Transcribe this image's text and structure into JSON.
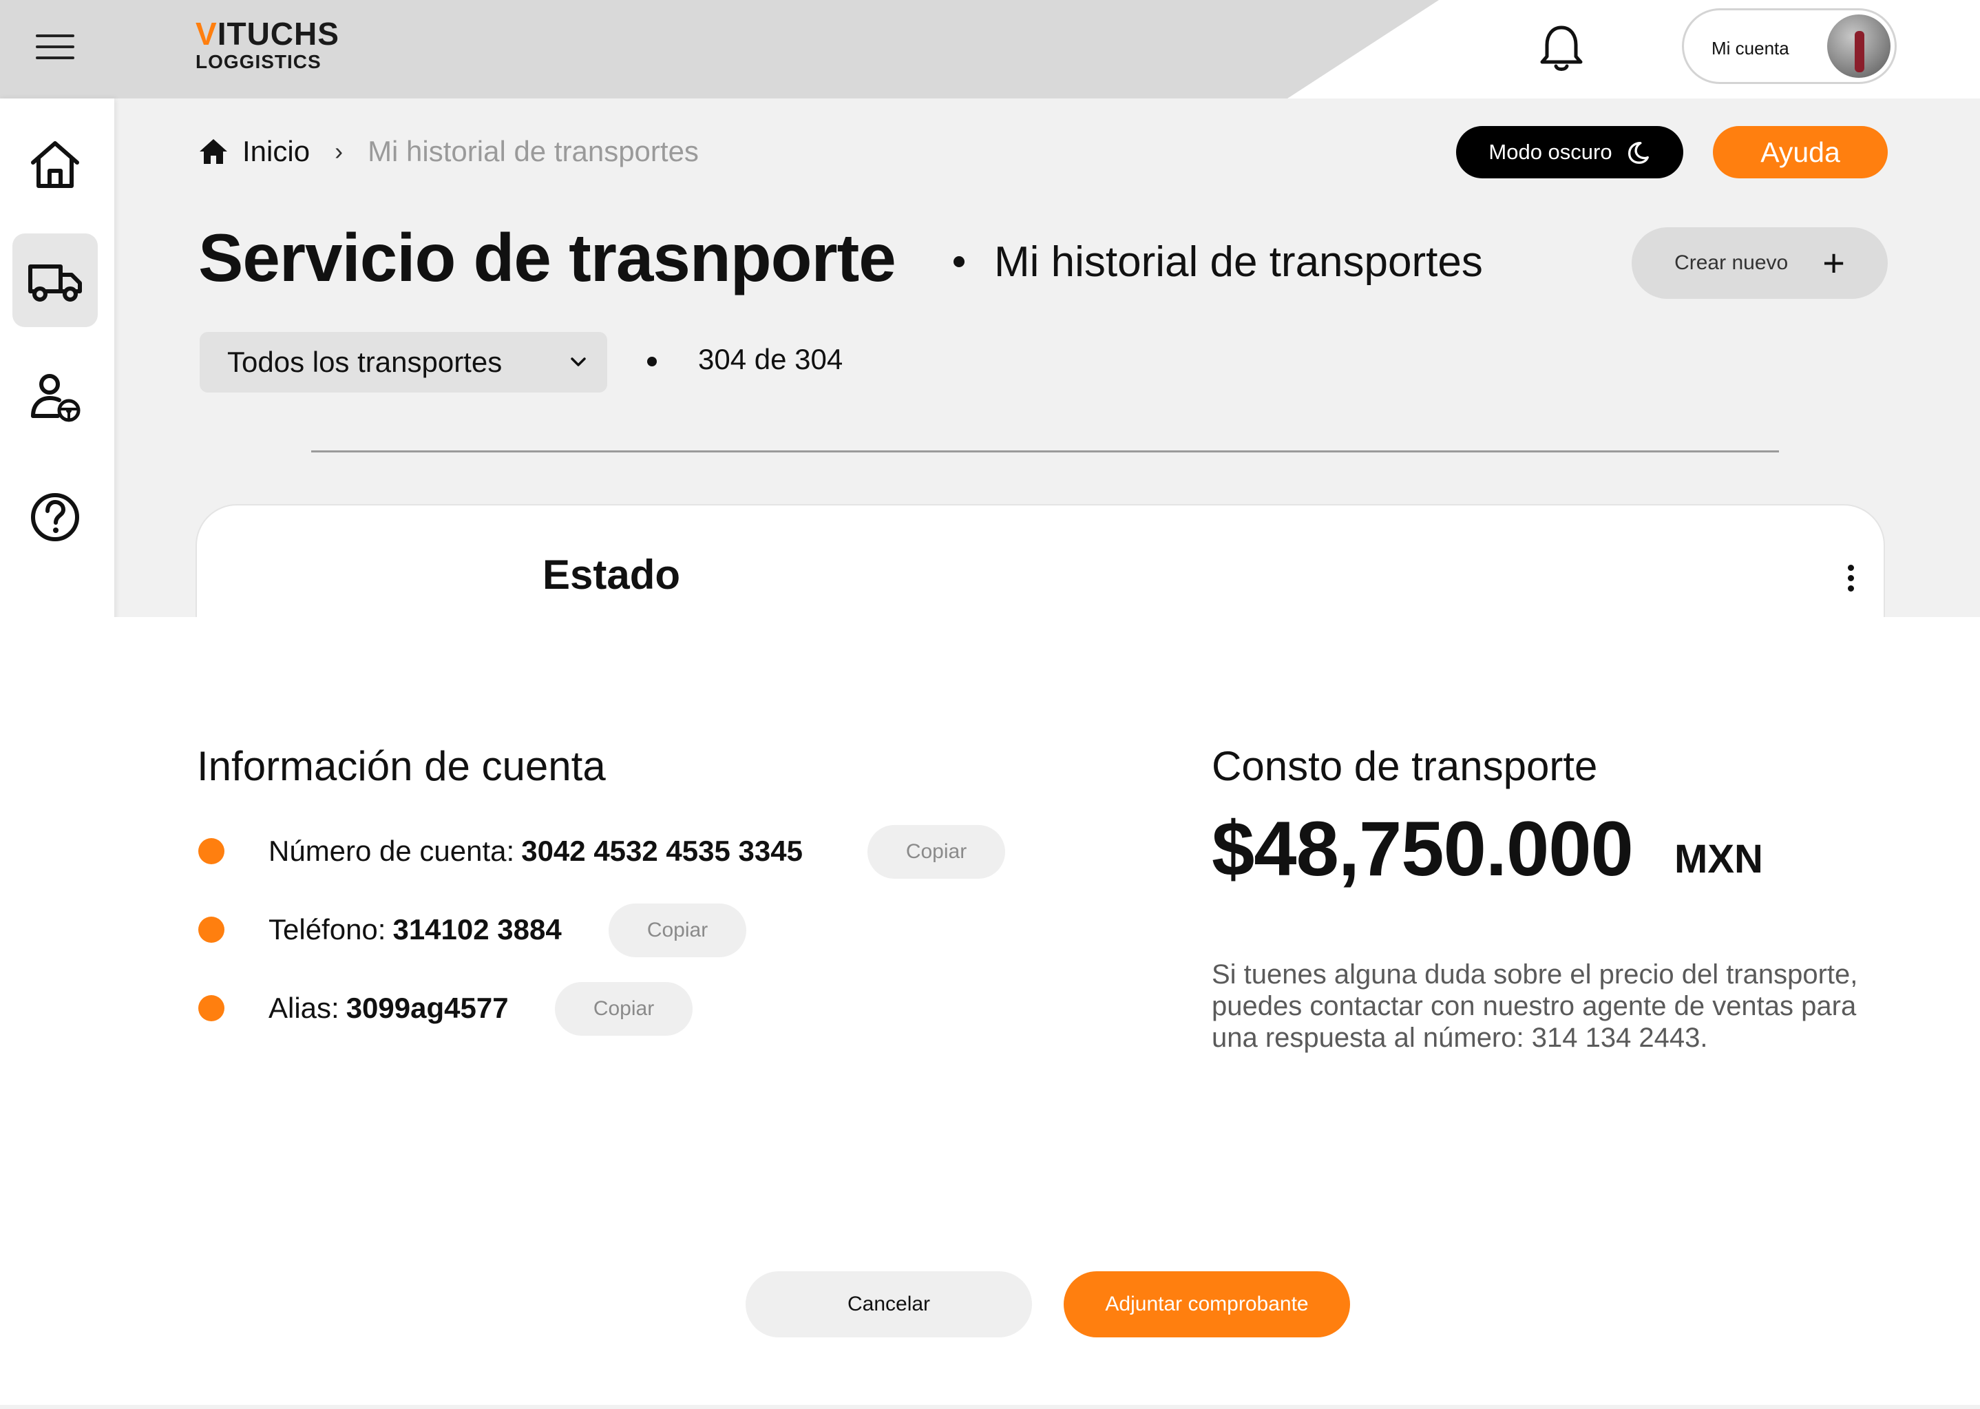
{
  "brand": {
    "name_accent": "V",
    "name_rest": "ITUCHS",
    "subtitle": "LOGGISTICS",
    "accent_color": "#ff7f0f"
  },
  "header": {
    "account_label": "Mi cuenta"
  },
  "sidebar": {
    "items": [
      {
        "name": "home",
        "icon": "home-icon",
        "active": false
      },
      {
        "name": "transport",
        "icon": "truck-icon",
        "active": true
      },
      {
        "name": "drivers",
        "icon": "driver-icon",
        "active": false
      },
      {
        "name": "help",
        "icon": "question-icon",
        "active": false
      }
    ]
  },
  "breadcrumb": {
    "home": "Inicio",
    "current": "Mi historial de transportes"
  },
  "actions": {
    "dark_mode": "Modo oscuro",
    "help": "Ayuda",
    "create_new": "Crear nuevo"
  },
  "page": {
    "title": "Servicio de trasnporte",
    "subtitle": "Mi historial de transportes",
    "filter": "Todos los transportes",
    "count": "304 de 304"
  },
  "card": {
    "title": "Estado"
  },
  "sheet": {
    "account_title": "Información de cuenta",
    "rows": [
      {
        "label": "Número de cuenta:",
        "value": "3042 4532 4535 3345",
        "copy": "Copiar"
      },
      {
        "label": "Teléfono:",
        "value": "314102 3884",
        "copy": "Copiar"
      },
      {
        "label": "Alias:",
        "value": "3099ag4577",
        "copy": "Copiar"
      }
    ],
    "cost_title": "Consto de transporte",
    "price": "$48,750.000",
    "currency": "MXN",
    "note": "Si tuenes alguna duda sobre el precio del transporte, puedes contactar con nuestro agente de ventas para una respuesta al número: 314 134 2443.",
    "cancel": "Cancelar",
    "attach": "Adjuntar comprobante"
  }
}
